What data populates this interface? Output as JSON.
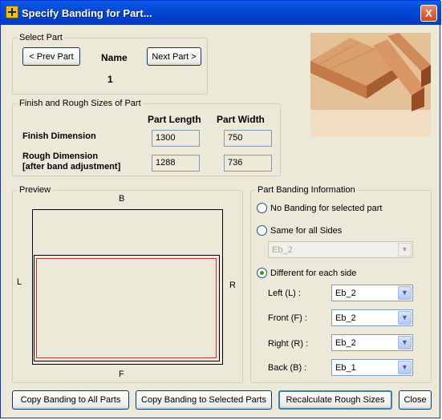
{
  "window": {
    "title": "Specify Banding for Part...",
    "close_glyph": "X"
  },
  "select_part": {
    "legend": "Select Part",
    "prev_button": "< Prev Part",
    "next_button": "Next Part >",
    "name_label": "Name",
    "part_number": "1"
  },
  "sizes": {
    "legend": "Finish and Rough Sizes of Part",
    "col_length": "Part Length",
    "col_width": "Part Width",
    "finish_label": "Finish Dimension",
    "rough_label_1": "Rough Dimension",
    "rough_label_2": "[after band adjustment]",
    "finish_length": "1300",
    "finish_width": "750",
    "rough_length": "1288",
    "rough_width": "736"
  },
  "preview": {
    "legend": "Preview",
    "side_back": "B",
    "side_left": "L",
    "side_right": "R",
    "side_front": "F"
  },
  "banding": {
    "legend": "Part Banding Information",
    "option_none": "No Banding for selected part",
    "option_same": "Same for all Sides",
    "same_value": "Eb_2",
    "option_different": "Different for each side",
    "selected_option": "Different for each side",
    "left_label": "Left (L) :",
    "left_value": "Eb_2",
    "front_label": "Front (F) :",
    "front_value": "Eb_2",
    "right_label": "Right (R) :",
    "right_value": "Eb_2",
    "back_label": "Back (B) :",
    "back_value": "Eb_1"
  },
  "footer": {
    "copy_all": "Copy Banding to All Parts",
    "copy_selected": "Copy Banding to Selected Parts",
    "recalculate": "Recalculate Rough Sizes",
    "close": "Close"
  },
  "colors": {
    "titlebar": "#0446d4",
    "dialog_bg": "#ece9d8",
    "inner_outline": "#c83232"
  },
  "icons": [
    "app-icon",
    "close-icon",
    "dropdown-arrow-icon",
    "wood-banding-photo"
  ]
}
